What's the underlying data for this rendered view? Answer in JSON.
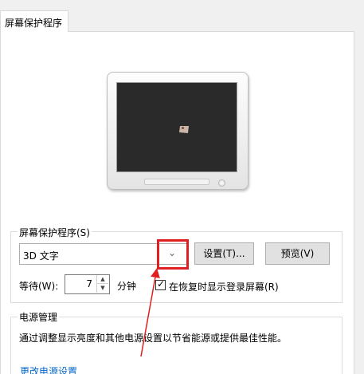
{
  "tabs": [
    {
      "label": "屏幕保护程序"
    }
  ],
  "screensaver_group": {
    "title": "屏幕保护程序(S)",
    "selected": "3D 文字",
    "settings_button": "设置(T)...",
    "preview_button": "预览(V)",
    "wait_label": "等待(W):",
    "wait_value": "7",
    "wait_unit": "分钟",
    "resume_checkbox": {
      "checked": true,
      "label": "在恢复时显示登录屏幕(R)"
    }
  },
  "power_group": {
    "title": "电源管理",
    "description": "通过调整显示亮度和其他电源设置以节省能源或提供最佳性能。",
    "link": "更改电源设置"
  },
  "annotation": {
    "color": "#e02020"
  }
}
